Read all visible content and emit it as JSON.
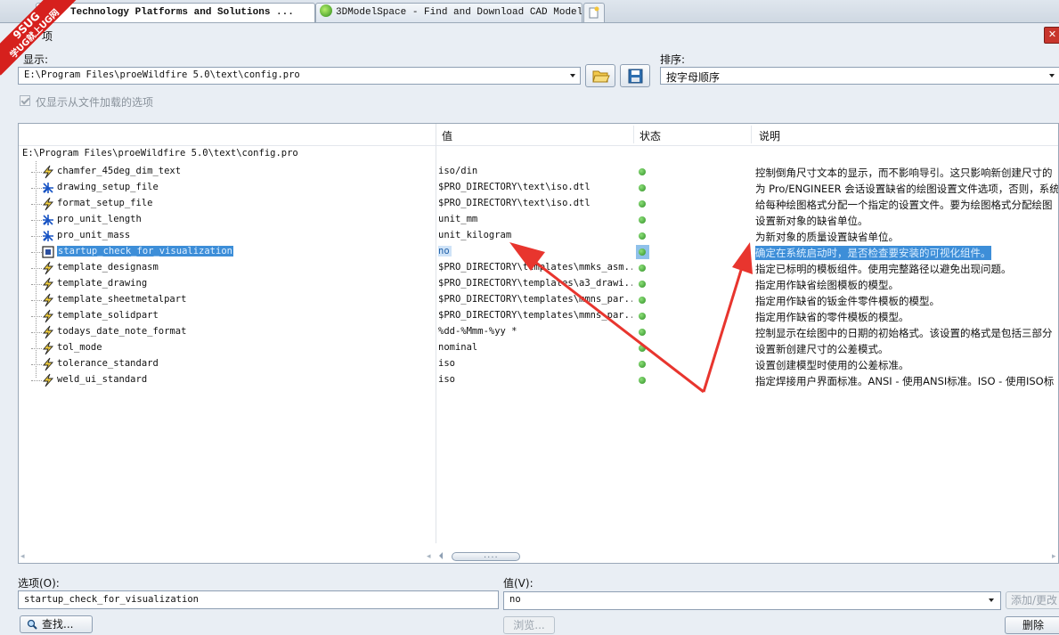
{
  "browser": {
    "tabs": [
      {
        "label": "Technology Platforms and Solutions ..."
      },
      {
        "label": "3DModelSpace - Find and Download CAD Model..."
      }
    ]
  },
  "watermark": {
    "line1": "9SUG",
    "line2": "学UG就上UG网"
  },
  "dialog": {
    "title_fragment": "项",
    "show_label": "显示:",
    "file_path": "E:\\Program Files\\proeWildfire 5.0\\text\\config.pro",
    "sort_label": "排序:",
    "sort_value": "按字母顺序",
    "only_loaded_checkbox": "仅显示从文件加载的选项",
    "columns": {
      "value": "值",
      "status": "状态",
      "description": "说明"
    },
    "root_path": "E:\\Program Files\\proeWildfire 5.0\\text\\config.pro",
    "rows": [
      {
        "name": "chamfer_45deg_dim_text",
        "value": "iso/din",
        "desc": "控制倒角尺寸文本的显示，而不影响导引。这只影响新创建尺寸的",
        "icon": "lightning-icon"
      },
      {
        "name": "drawing_setup_file",
        "value": "$PRO_DIRECTORY\\text\\iso.dtl",
        "desc": "为 Pro/ENGINEER 会话设置缺省的绘图设置文件选项，否则，系统",
        "icon": "star-icon"
      },
      {
        "name": "format_setup_file",
        "value": "$PRO_DIRECTORY\\text\\iso.dtl",
        "desc": "给每种绘图格式分配一个指定的设置文件。要为绘图格式分配绘图",
        "icon": "lightning-icon"
      },
      {
        "name": "pro_unit_length",
        "value": "unit_mm",
        "desc": "设置新对象的缺省单位。",
        "icon": "star-icon"
      },
      {
        "name": "pro_unit_mass",
        "value": "unit_kilogram",
        "desc": "为新对象的质量设置缺省单位。",
        "icon": "star-icon"
      },
      {
        "name": "startup_check_for_visualization",
        "value": "no",
        "desc": "确定在系统启动时，是否检查要安装的可视化组件。",
        "icon": "window-icon",
        "selected": true
      },
      {
        "name": "template_designasm",
        "value": "$PRO_DIRECTORY\\templates\\mmks_asm...",
        "desc": "指定已标明的模板组件。使用完整路径以避免出现问题。",
        "icon": "lightning-icon"
      },
      {
        "name": "template_drawing",
        "value": "$PRO_DIRECTORY\\templates\\a3_drawi...",
        "desc": "指定用作缺省绘图模板的模型。",
        "icon": "lightning-icon"
      },
      {
        "name": "template_sheetmetalpart",
        "value": "$PRO_DIRECTORY\\templates\\mmns_par...",
        "desc": "指定用作缺省的钣金件零件模板的模型。",
        "icon": "lightning-icon"
      },
      {
        "name": "template_solidpart",
        "value": "$PRO_DIRECTORY\\templates\\mmns_par...",
        "desc": "指定用作缺省的零件模板的模型。",
        "icon": "lightning-icon"
      },
      {
        "name": "todays_date_note_format",
        "value": "%dd-%Mmm-%yy *",
        "desc": "控制显示在绘图中的日期的初始格式。该设置的格式是包括三部分",
        "icon": "lightning-icon"
      },
      {
        "name": "tol_mode",
        "value": "nominal",
        "desc": "设置新创建尺寸的公差模式。",
        "icon": "lightning-icon"
      },
      {
        "name": "tolerance_standard",
        "value": "iso",
        "desc": "设置创建模型时使用的公差标准。",
        "icon": "lightning-icon"
      },
      {
        "name": "weld_ui_standard",
        "value": "iso",
        "desc": "指定焊接用户界面标准。ANSI - 使用ANSI标准。ISO - 使用ISO标",
        "icon": "lightning-icon"
      }
    ],
    "option_label": "选项(O):",
    "option_value": "startup_check_for_visualization",
    "value_label": "值(V):",
    "value_value": "no",
    "add_change_button": "添加/更改",
    "find_button": "查找...",
    "browse_button": "浏览...",
    "delete_button": "删除",
    "scroll_grip": "....",
    "colors": {
      "selection": "#3d8ed8",
      "status_ok": "#2e8f25",
      "annotation_arrow": "#e8352e"
    }
  }
}
